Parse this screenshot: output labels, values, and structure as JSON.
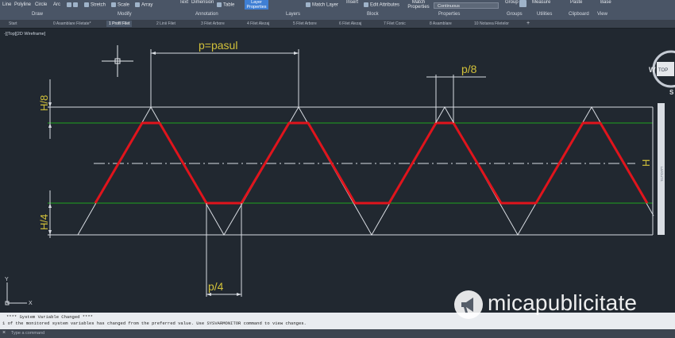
{
  "ribbon": {
    "draw_tools": {
      "line": "Line",
      "polyline": "Polyline",
      "circle": "Circle",
      "arc": "Arc"
    },
    "modify_tools": {
      "stretch": "Stretch",
      "scale": "Scale",
      "array": "Array"
    },
    "annotation_tools": {
      "text": "Text",
      "dimension": "Dimension",
      "table": "Table"
    },
    "layer_properties": "Layer Properties",
    "match_layer": "Match Layer",
    "insert": "Insert",
    "edit_attributes": "Edit Attributes",
    "match_properties": "Match Properties",
    "linetype": "Continuous",
    "group": "Group",
    "measure": "Measure",
    "paste": "Paste",
    "base": "Base",
    "panels": {
      "draw": "Draw",
      "modify": "Modify",
      "annotation": "Annotation",
      "layers": "Layers",
      "block": "Block",
      "properties": "Properties",
      "groups": "Groups",
      "utilities": "Utilities",
      "clipboard": "Clipboard",
      "view": "View"
    }
  },
  "tabs": [
    "Start",
    "0 Asamblare Filetate*",
    "1 Profil Filet",
    "2 Linii Filet",
    "3 Filet Arbore",
    "4 Filet Alezaj",
    "5 Filet Arbore",
    "6 Filet Alezaj",
    "7 Filet Conic",
    "8 Asamblare",
    "10 Notarea Filetelor"
  ],
  "viewport_label": "-][Top][2D Wireframe]",
  "drawing": {
    "labels": {
      "pasul": "p=pasul",
      "p8": "p/8",
      "p4": "p/4",
      "h8": "H/8",
      "h4": "H/4",
      "h": "H"
    },
    "ucs": {
      "y": "Y",
      "x": "X"
    },
    "compass": {
      "west": "W",
      "top": "TOP",
      "south": "S"
    },
    "colors": {
      "profile": "#e0141c",
      "guides": "#1ea51e",
      "construction": "#d8dce2",
      "labels": "#d2c13a"
    }
  },
  "command": {
    "history": [
      "**** System Variable Changed ****",
      "1 of the monitored system variables has changed from the preferred value. Use SYSVARMONITOR command to view changes."
    ],
    "placeholder": "Type a command"
  },
  "navbar_text": "LAYOUTS",
  "watermark": "micapublicitate"
}
